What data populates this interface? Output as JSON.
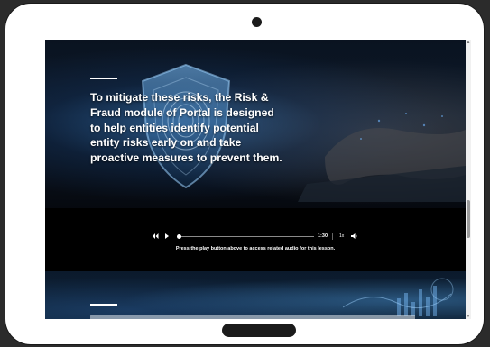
{
  "hero": {
    "text": "To mitigate these risks, the Risk & Fraud module of Portal is designed to help entities identify potential entity risks early on and take proactive measures to prevent them."
  },
  "audio": {
    "time": "1:30",
    "speed": "1x",
    "progress": 0,
    "caption": "Press the play button above to access related audio for this lesson."
  },
  "icons": {
    "rewind": "rewind-icon",
    "play": "play-icon",
    "volume": "volume-icon"
  },
  "colors": {
    "device_frame": "#ffffff",
    "background": "#2b2b2b",
    "panel": "#000000"
  }
}
